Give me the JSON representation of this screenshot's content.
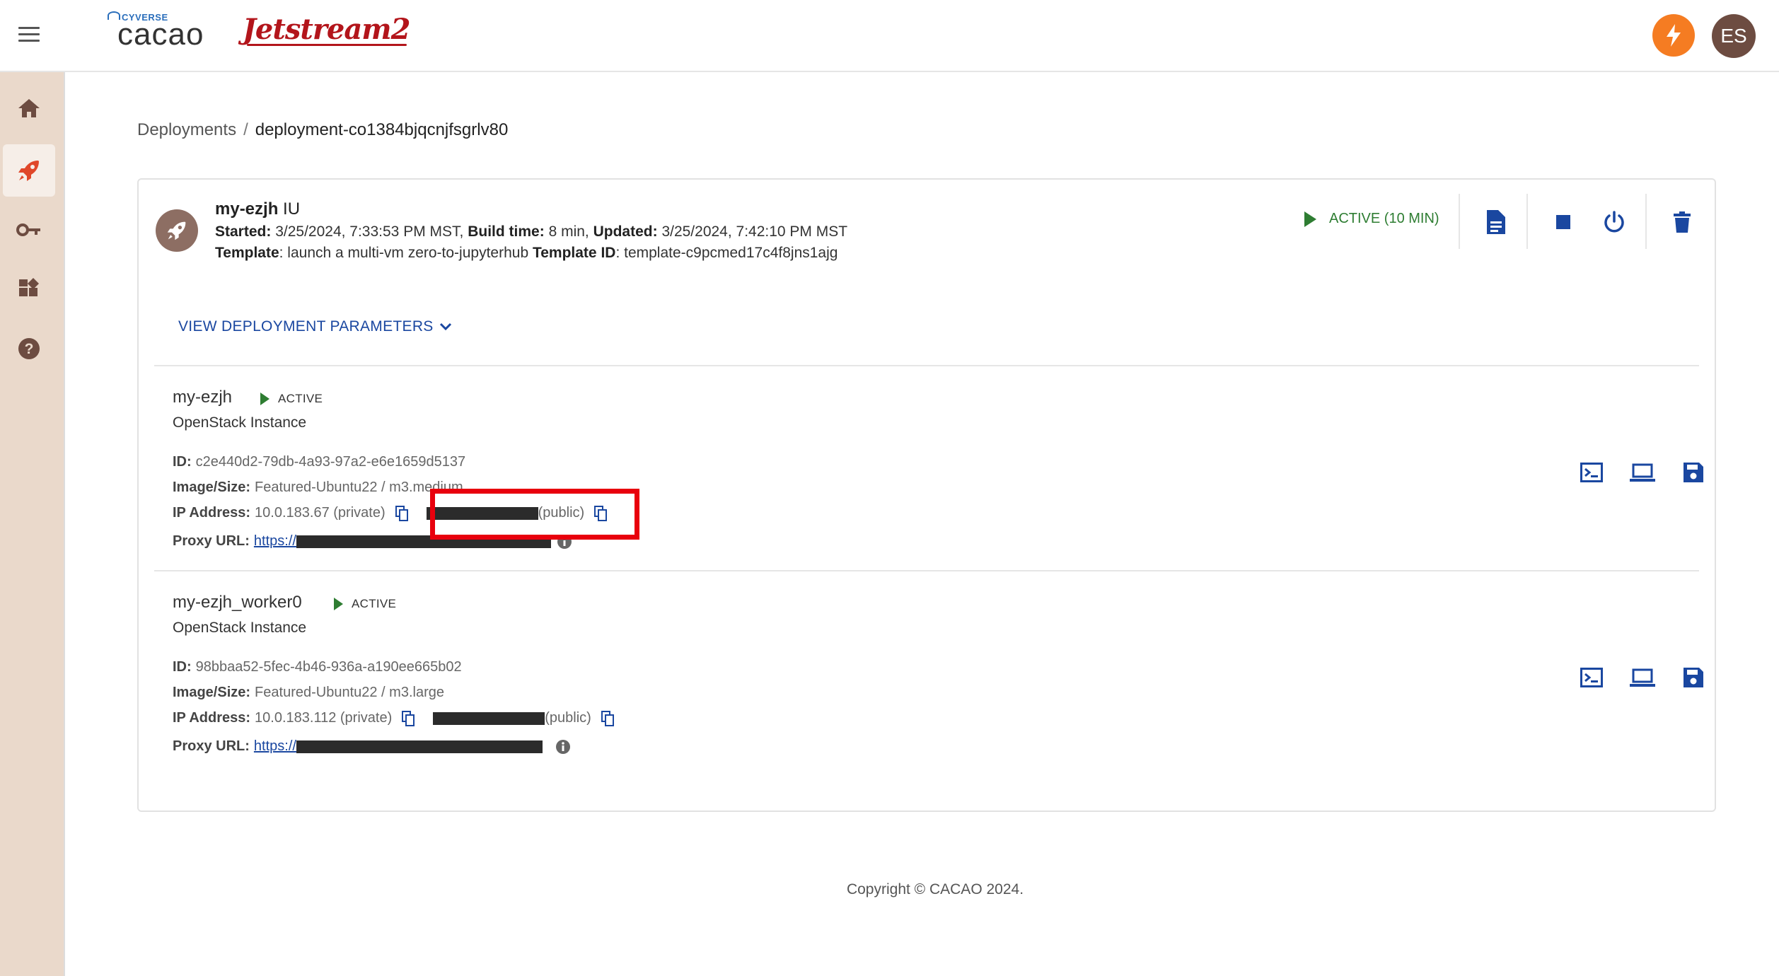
{
  "header": {
    "brand_small": "CYVERSE",
    "brand": "cacao",
    "partner_logo": "Jetstream2",
    "avatar_initials": "ES",
    "colors": {
      "accent": "#f57c22",
      "avatar_bg": "#6d4c41",
      "sidebar_bg": "#ead9cb",
      "primary": "#1a47a0",
      "active": "#2e7d32"
    }
  },
  "sidebar": {
    "items": [
      {
        "icon": "home-icon",
        "active": false
      },
      {
        "icon": "rocket-icon",
        "active": true
      },
      {
        "icon": "key-icon",
        "active": false
      },
      {
        "icon": "widgets-icon",
        "active": false
      },
      {
        "icon": "help-icon",
        "active": false
      }
    ]
  },
  "breadcrumb": {
    "root": "Deployments",
    "separator": "/",
    "current": "deployment-co1384bjqcnjfsgrlv80"
  },
  "deployment": {
    "name": "my-ezjh",
    "region": "IU",
    "started_label": "Started:",
    "started": "3/25/2024, 7:33:53 PM MST,",
    "build_time_label": "Build time:",
    "build_time": "8 min,",
    "updated_label": "Updated:",
    "updated": "3/25/2024, 7:42:10 PM MST",
    "template_label": "Template",
    "template": ": launch a multi-vm zero-to-jupyterhub",
    "template_id_label": "Template ID",
    "template_id": ": template-c9pcmed17c4f8jns1ajg",
    "status": "ACTIVE (10 MIN)",
    "view_params": "VIEW DEPLOYMENT PARAMETERS"
  },
  "instances": [
    {
      "name": "my-ezjh",
      "status": "ACTIVE",
      "type": "OpenStack Instance",
      "id_label": "ID:",
      "id": "c2e440d2-79db-4a93-97a2-e6e1659d5137",
      "image_label": "Image/Size:",
      "image": "Featured-Ubuntu22 / m3.medium",
      "ip_label": "IP Address:",
      "private_ip": "10.0.183.67 (private)",
      "public_suffix": "(public)",
      "proxy_label": "Proxy URL:",
      "proxy_prefix": "https://"
    },
    {
      "name": "my-ezjh_worker0",
      "status": "ACTIVE",
      "type": "OpenStack Instance",
      "id_label": "ID:",
      "id": "98bbaa52-5fec-4b46-936a-a190ee665b02",
      "image_label": "Image/Size:",
      "image": "Featured-Ubuntu22 / m3.large",
      "ip_label": "IP Address:",
      "private_ip": "10.0.183.112 (private)",
      "public_suffix": "(public)",
      "proxy_label": "Proxy URL:",
      "proxy_prefix": "https://"
    }
  ],
  "footer": {
    "copyright": "Copyright © CACAO 2024."
  }
}
